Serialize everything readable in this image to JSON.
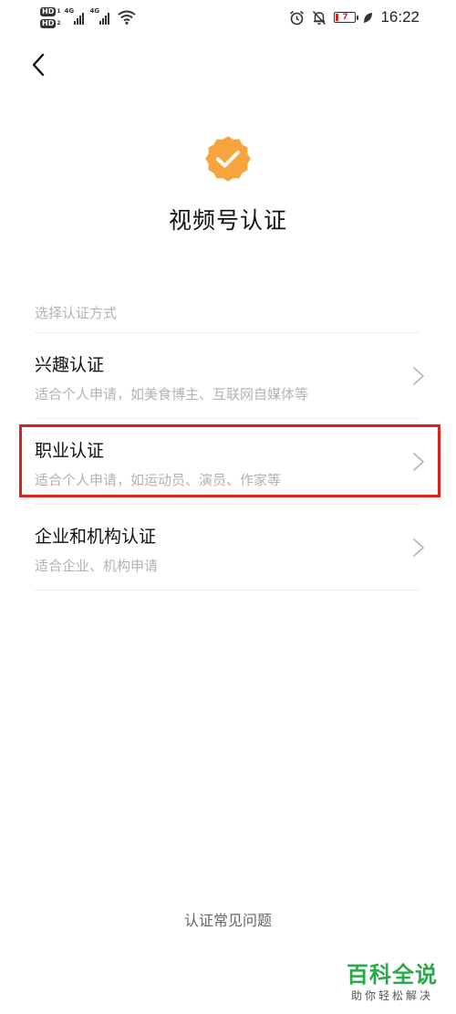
{
  "status_bar": {
    "time": "16:22",
    "hd_badge": "HD",
    "network_label": "4G",
    "battery_level": "7",
    "icons": [
      "hd-icon",
      "signal-icon",
      "wifi-icon",
      "alarm-icon",
      "mute-icon",
      "battery-icon",
      "leaf-icon"
    ]
  },
  "nav": {
    "back_icon": "chevron-left-icon"
  },
  "header": {
    "badge_icon": "verified-badge-icon",
    "badge_color": "#f6a53c",
    "title": "视频号认证"
  },
  "options_section": {
    "label": "选择认证方式",
    "items": [
      {
        "title": "兴趣认证",
        "desc": "适合个人申请，如美食博主、互联网自媒体等",
        "highlighted": false
      },
      {
        "title": "职业认证",
        "desc": "适合个人申请，如运动员、演员、作家等",
        "highlighted": true
      },
      {
        "title": "企业和机构认证",
        "desc": "适合企业、机构申请",
        "highlighted": false
      }
    ],
    "highlight_color": "#d9241c"
  },
  "footer": {
    "faq_link": "认证常见问题"
  },
  "watermark": {
    "main": "百科全说",
    "sub": "助你轻松解决",
    "color": "#2ba84a"
  }
}
